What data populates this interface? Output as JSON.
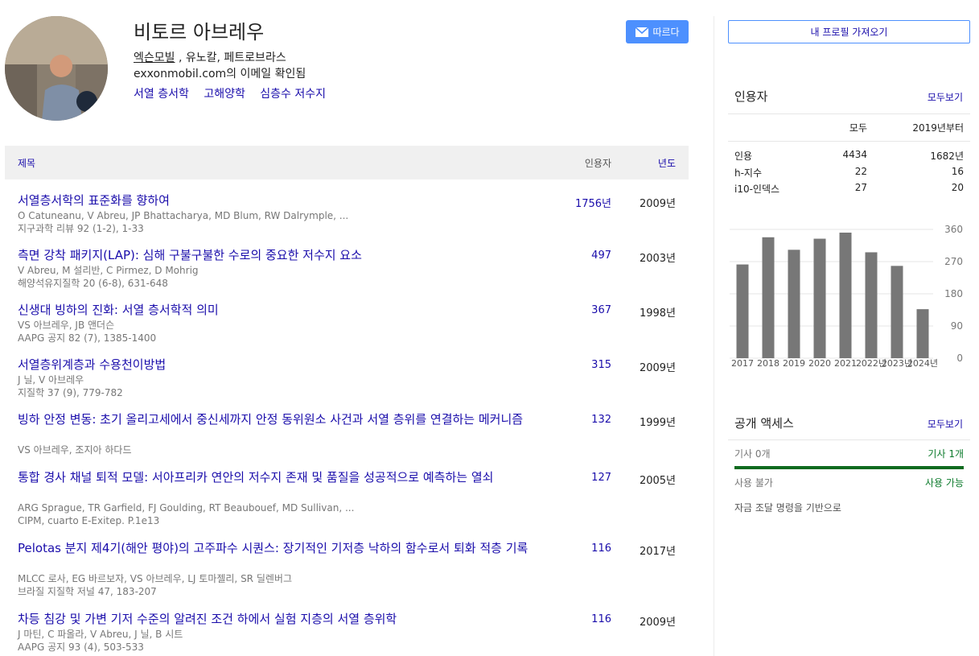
{
  "profile": {
    "name": "비토르 아브레우",
    "affiliation_link": "엑슨모빌",
    "affiliation_rest": " , 유노칼, 페트로브라스",
    "email_verified": "exxonmobil.com의 이메일 확인됨",
    "interests": [
      "서열 층서학",
      "고해양학",
      "심층수 저수지"
    ],
    "follow_label": "따르다"
  },
  "table": {
    "header": {
      "title": "제목",
      "cited_by": "인용자",
      "year": "년도"
    },
    "rows": [
      {
        "title": "서열층서학의 표준화를 향하여",
        "authors": "O Catuneanu, V Abreu, JP Bhattacharya, MD Blum, RW Dalrymple, ...",
        "venue": "지구과학 리뷰 92 (1-2), 1-33",
        "cited": "1756년",
        "year": "2009년"
      },
      {
        "title": "측면 강착 패키지(LAP): 심해 구불구불한 수로의 중요한 저수지 요소",
        "authors": "V Abreu, M 설리반, C Pirmez, D Mohrig",
        "venue": "해양석유지질학 20 (6-8), 631-648",
        "cited": "497",
        "year": "2003년"
      },
      {
        "title": "신생대 빙하의 진화: 서열 층서학적 의미",
        "authors": "VS 아브레우, JB 앤더슨",
        "venue": "AAPG 공지 82 (7), 1385-1400",
        "cited": "367",
        "year": "1998년"
      },
      {
        "title": "서열층위계층과 수용천이방법",
        "authors": "J 닐, V 아브레우",
        "venue": "지질학 37 (9), 779-782",
        "cited": "315",
        "year": "2009년"
      },
      {
        "title": "빙하 안정 변동: 초기 올리고세에서 중신세까지 안정 동위원소 사건과 서열 층위를 연결하는 메커니즘",
        "authors": "VS 아브레우, 조지아 하다드",
        "venue": "",
        "cited": "132",
        "year": "1999년"
      },
      {
        "title": "통합 경사 채널 퇴적 모델: 서아프리카 연안의 저수지 존재 및 품질을 성공적으로 예측하는 열쇠",
        "authors": "ARG Sprague, TR Garfield, FJ Goulding, RT Beaubouef, MD Sullivan, ...",
        "venue": "CIPM, cuarto E-Exitep. P.1e13",
        "cited": "127",
        "year": "2005년"
      },
      {
        "title": "Pelotas 분지 제4기(해안 평야)의 고주파수 시퀀스: 장기적인 기저층 낙하의 함수로서 퇴화 적층 기록",
        "authors": "MLCC 로사, EG 바르보자, VS 아브레우, LJ 토마젤리, SR 딜렌버그",
        "venue": "브라질 지질학 저널 47, 183-207",
        "cited": "116",
        "year": "2017년"
      },
      {
        "title": "차등 침강 및 가변 기저 수준의 알려진 조건 하에서 실험 지층의 서열 층위학",
        "authors": "J 마틴, C 파올라, V Abreu, J 닐, B 시트",
        "venue": "AAPG 공지 93 (4), 503-533",
        "cited": "116",
        "year": "2009년"
      }
    ]
  },
  "sidebar": {
    "import_label": "내 프로필 가져오기",
    "cited_by": {
      "title": "인용자",
      "see_all": "모두보기",
      "col_all": "모두",
      "col_since": "2019년부터",
      "rows": [
        {
          "label": "인용",
          "all": "4434",
          "since": "1682년"
        },
        {
          "label": "h-지수",
          "all": "22",
          "since": "16"
        },
        {
          "label": "i10-인덱스",
          "all": "27",
          "since": "20"
        }
      ]
    },
    "public_access": {
      "title": "공개 액세스",
      "see_all": "모두보기",
      "not_available": "기사 0개",
      "available": "기사 1개",
      "not_available_label": "사용 불가",
      "available_label": "사용 가능",
      "note": "자금 조달 명령을 기반으로"
    }
  },
  "chart_data": {
    "type": "bar",
    "categories": [
      "2017",
      "2018",
      "2019",
      "2020",
      "2021",
      "2022년",
      "2023년",
      "2024년"
    ],
    "values": [
      262,
      338,
      303,
      334,
      351,
      296,
      258,
      137
    ],
    "ylim": [
      0,
      360
    ],
    "yticks": [
      "0",
      "90",
      "180",
      "270",
      "360"
    ],
    "bar_color": "#777777",
    "grid": true
  }
}
